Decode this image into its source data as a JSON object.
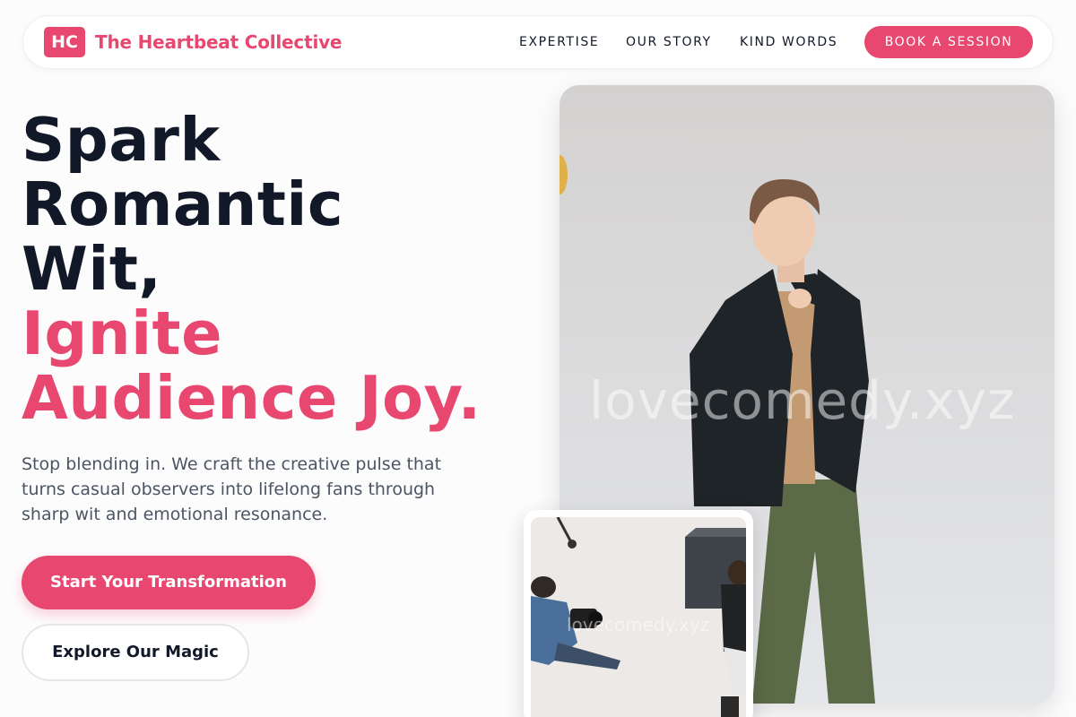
{
  "header": {
    "logo_initials": "HC",
    "brand_name": "The Heartbeat Collective",
    "nav": [
      "EXPERTISE",
      "OUR STORY",
      "KIND WORDS"
    ],
    "cta_label": "BOOK A SESSION"
  },
  "hero": {
    "headline_dark": [
      "Spark",
      "Romantic",
      "Wit,"
    ],
    "headline_accent": [
      "Ignite",
      "Audience Joy."
    ],
    "subtext": "Stop blending in. We craft the creative pulse that turns casual observers into lifelong fans through sharp wit and emotional resonance.",
    "primary_cta": "Start Your Transformation",
    "secondary_cta": "Explore Our Magic"
  },
  "media": {
    "main_watermark": "lovecomedy.xyz",
    "small_watermark": "lovecomedy.xyz"
  },
  "colors": {
    "accent": "#e8476f",
    "heading": "#111827",
    "body_text": "#4b5563"
  }
}
